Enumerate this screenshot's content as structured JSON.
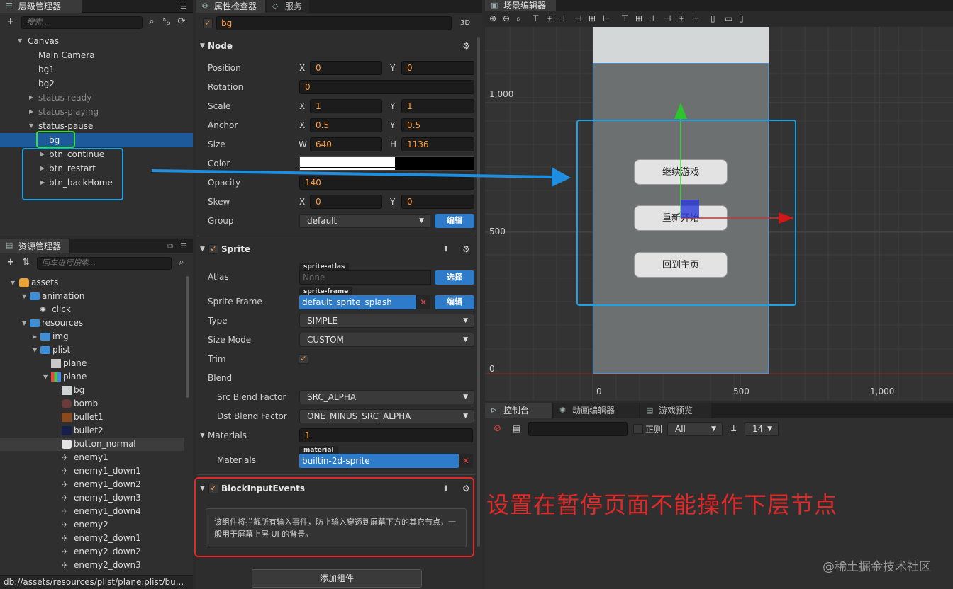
{
  "hierarchy": {
    "title": "层级管理器",
    "search_placeholder": "搜索...",
    "nodes": [
      {
        "label": "Canvas"
      },
      {
        "label": "Main Camera"
      },
      {
        "label": "bg1"
      },
      {
        "label": "bg2"
      },
      {
        "label": "status-ready"
      },
      {
        "label": "status-playing"
      },
      {
        "label": "status-pause"
      },
      {
        "label": "bg"
      },
      {
        "label": "btn_continue"
      },
      {
        "label": "btn_restart"
      },
      {
        "label": "btn_backHome"
      }
    ]
  },
  "assets": {
    "title": "资源管理器",
    "search_placeholder": "回车进行搜索...",
    "items": [
      {
        "label": "assets"
      },
      {
        "label": "animation"
      },
      {
        "label": "click"
      },
      {
        "label": "resources"
      },
      {
        "label": "img"
      },
      {
        "label": "plist"
      },
      {
        "label": "plane"
      },
      {
        "label": "plane"
      },
      {
        "label": "bg"
      },
      {
        "label": "bomb"
      },
      {
        "label": "bullet1"
      },
      {
        "label": "bullet2"
      },
      {
        "label": "button_normal"
      },
      {
        "label": "enemy1"
      },
      {
        "label": "enemy1_down1"
      },
      {
        "label": "enemy1_down2"
      },
      {
        "label": "enemy1_down3"
      },
      {
        "label": "enemy1_down4"
      },
      {
        "label": "enemy2"
      },
      {
        "label": "enemy2_down1"
      },
      {
        "label": "enemy2_down2"
      },
      {
        "label": "enemy2_down3"
      }
    ],
    "status_path": "db://assets/resources/plist/plane.plist/bu..."
  },
  "inspector": {
    "tab_label": "属性检查器",
    "tab2_label": "服务",
    "node_name": "bg",
    "mode_3d": "3D",
    "node_section": "Node",
    "labels": {
      "position": "Position",
      "rotation": "Rotation",
      "scale": "Scale",
      "anchor": "Anchor",
      "size": "Size",
      "color": "Color",
      "opacity": "Opacity",
      "skew": "Skew",
      "group": "Group"
    },
    "axis": {
      "x": "X",
      "y": "Y",
      "w": "W",
      "h": "H"
    },
    "values": {
      "pos_x": "0",
      "pos_y": "0",
      "rotation": "0",
      "scale_x": "1",
      "scale_y": "1",
      "anchor_x": "0.5",
      "anchor_y": "0.5",
      "width": "640",
      "height": "1136",
      "opacity": "140",
      "skew_x": "0",
      "skew_y": "0",
      "group": "default"
    },
    "edit_label": "编辑",
    "sprite_section": "Sprite",
    "sprite_labels": {
      "atlas": "Atlas",
      "sprite_frame": "Sprite Frame",
      "type": "Type",
      "size_mode": "Size Mode",
      "trim": "Trim",
      "blend": "Blend",
      "src_blend": "Src Blend Factor",
      "dst_blend": "Dst Blend Factor",
      "materials": "Materials",
      "materials_item": "Materials"
    },
    "sprite_values": {
      "atlas_tag": "sprite-atlas",
      "atlas_value": "None",
      "select_label": "选择",
      "frame_tag": "sprite-frame",
      "frame_value": "default_sprite_splash",
      "type": "SIMPLE",
      "size_mode": "CUSTOM",
      "src_blend": "SRC_ALPHA",
      "dst_blend": "ONE_MINUS_SRC_ALPHA",
      "materials_count": "1",
      "material_tag": "material",
      "material_value": "builtin-2d-sprite"
    },
    "block_section": "BlockInputEvents",
    "block_desc": "该组件将拦截所有输入事件，防止输入穿透到屏幕下方的其它节点，一般用于屏幕上层 UI 的背景。",
    "add_component": "添加组件"
  },
  "scene": {
    "title": "场景编辑器",
    "rulers": {
      "y_1000": "1,000",
      "y_500": "500",
      "y_0": "0",
      "x_0": "0",
      "x_500": "500",
      "x_1000": "1,000"
    },
    "buttons": [
      "继续游戏",
      "重新开始",
      "回到主页"
    ]
  },
  "bottom": {
    "tabs": [
      "控制台",
      "动画编辑器",
      "游戏预览"
    ],
    "regex_label": "正则",
    "level": "All",
    "font_size": "14"
  },
  "annotation": {
    "text": "设置在暂停页面不能操作下层节点"
  },
  "watermark": "@稀土掘金技术社区",
  "colors": {
    "selection": "#1d5a9c",
    "accent_orange": "#ff9c3a",
    "button_blue": "#2e7bc9",
    "annotation_red": "#e02a2a",
    "highlight_cyan": "#1ea0e6",
    "highlight_green": "#3ddc3d"
  }
}
